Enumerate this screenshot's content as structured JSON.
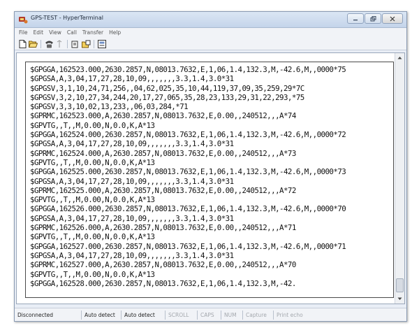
{
  "window": {
    "title": "GPS-TEST - HyperTerminal"
  },
  "menu": [
    "File",
    "Edit",
    "View",
    "Call",
    "Transfer",
    "Help"
  ],
  "toolbar": [
    "new-icon",
    "open-icon",
    "phone-icon",
    "disconnect-icon",
    "send-icon",
    "receive-icon",
    "properties-icon"
  ],
  "terminal": {
    "lines": [
      "$GPGGA,162523.000,2630.2857,N,08013.7632,E,1,06,1.4,132.3,M,-42.6,M,,0000*75",
      "$GPGSA,A,3,04,17,27,28,10,09,,,,,,,3.3,1.4,3.0*31",
      "$GPGSV,3,1,10,24,71,256,,04,62,025,35,10,44,119,37,09,35,259,29*7C",
      "$GPGSV,3,2,10,27,34,244,20,17,27,065,35,28,23,133,29,31,22,293,*75",
      "$GPGSV,3,3,10,02,13,233,,06,03,284,*71",
      "$GPRMC,162523.000,A,2630.2857,N,08013.7632,E,0.00,,240512,,,A*74",
      "$GPVTG,,T,,M,0.00,N,0.0,K,A*13",
      "$GPGGA,162524.000,2630.2857,N,08013.7632,E,1,06,1.4,132.3,M,-42.6,M,,0000*72",
      "$GPGSA,A,3,04,17,27,28,10,09,,,,,,,3.3,1.4,3.0*31",
      "$GPRMC,162524.000,A,2630.2857,N,08013.7632,E,0.00,,240512,,,A*73",
      "$GPVTG,,T,,M,0.00,N,0.0,K,A*13",
      "$GPGGA,162525.000,2630.2857,N,08013.7632,E,1,06,1.4,132.3,M,-42.6,M,,0000*73",
      "$GPGSA,A,3,04,17,27,28,10,09,,,,,,,3.3,1.4,3.0*31",
      "$GPRMC,162525.000,A,2630.2857,N,08013.7632,E,0.00,,240512,,,A*72",
      "$GPVTG,,T,,M,0.00,N,0.0,K,A*13",
      "$GPGGA,162526.000,2630.2857,N,08013.7632,E,1,06,1.4,132.3,M,-42.6,M,,0000*70",
      "$GPGSA,A,3,04,17,27,28,10,09,,,,,,,3.3,1.4,3.0*31",
      "$GPRMC,162526.000,A,2630.2857,N,08013.7632,E,0.00,,240512,,,A*71",
      "$GPVTG,,T,,M,0.00,N,0.0,K,A*13",
      "$GPGGA,162527.000,2630.2857,N,08013.7632,E,1,06,1.4,132.3,M,-42.6,M,,0000*71",
      "$GPGSA,A,3,04,17,27,28,10,09,,,,,,,3.3,1.4,3.0*31",
      "$GPRMC,162527.000,A,2630.2857,N,08013.7632,E,0.00,,240512,,,A*70",
      "$GPVTG,,T,,M,0.00,N,0.0,K,A*13",
      "$GPGGA,162528.000,2630.2857,N,08013.7632,E,1,06,1.4,132.3,M,-42."
    ]
  },
  "status": {
    "connection": "Disconnected",
    "detect1": "Auto detect",
    "detect2": "Auto detect",
    "scroll": "SCROLL",
    "caps": "CAPS",
    "num": "NUM",
    "capture": "Capture",
    "print": "Print echo"
  }
}
